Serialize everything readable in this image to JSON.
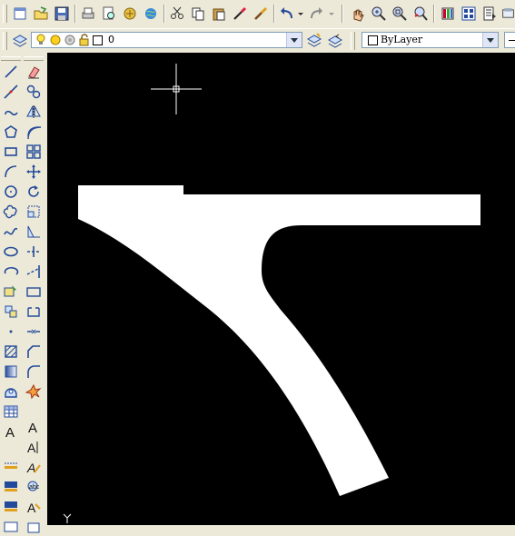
{
  "layer_combo": {
    "value": "0"
  },
  "color_combo": {
    "value": "ByLayer"
  },
  "ucs_label": "Y",
  "toolbar1_icons": [
    "new-file-icon",
    "open-file-icon",
    "save-icon",
    "print-icon",
    "print-preview-icon",
    "publish-icon",
    "plot-icon",
    "cut-icon",
    "copy-icon",
    "paste-icon",
    "match-properties-icon",
    "paintbrush-icon",
    "undo-icon",
    "redo-icon",
    "pan-icon",
    "zoom-realtime-icon",
    "zoom-window-icon",
    "zoom-previous-icon",
    "properties-icon",
    "design-center-icon",
    "tool-palettes-icon",
    "sheet-set-icon"
  ],
  "draw_tools": [
    "line-icon",
    "construction-line-icon",
    "polyline-icon",
    "polygon-icon",
    "rectangle-icon",
    "arc-icon",
    "circle-icon",
    "revision-cloud-icon",
    "spline-icon",
    "ellipse-icon",
    "ellipse-arc-icon",
    "insert-block-icon",
    "make-block-icon",
    "point-icon",
    "hatch-icon",
    "gradient-icon",
    "region-icon",
    "table-icon",
    "multiline-text-icon"
  ],
  "modify_tools": [
    "erase-icon",
    "copy-object-icon",
    "mirror-icon",
    "offset-icon",
    "array-icon",
    "move-icon",
    "rotate-icon",
    "scale-icon",
    "stretch-icon",
    "trim-icon",
    "extend-icon",
    "break-at-point-icon",
    "break-icon",
    "join-icon",
    "chamfer-icon",
    "fillet-icon",
    "explode-icon"
  ]
}
